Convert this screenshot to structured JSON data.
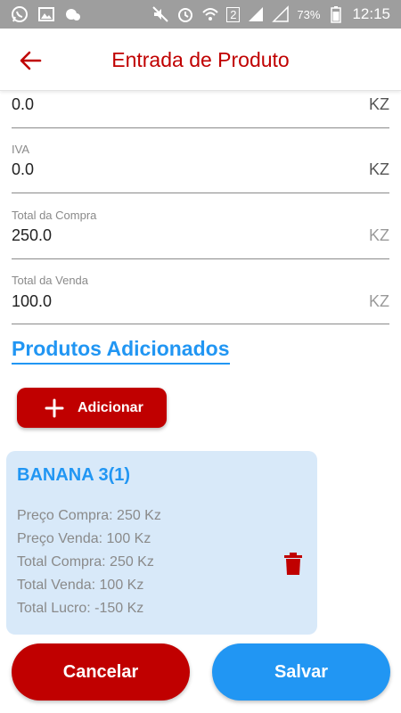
{
  "status_bar": {
    "battery": "73%",
    "time": "12:15",
    "sim_badge": "2"
  },
  "app_bar": {
    "title": "Entrada de Produto"
  },
  "fields": [
    {
      "label": "",
      "value": "0.0",
      "unit": "KZ"
    },
    {
      "label": "IVA",
      "value": "0.0",
      "unit": "KZ"
    },
    {
      "label": "Total da Compra",
      "value": "250.0",
      "unit": "KZ"
    },
    {
      "label": "Total da Venda",
      "value": "100.0",
      "unit": "KZ"
    }
  ],
  "section": {
    "title": "Produtos Adicionados"
  },
  "add_button": {
    "label": "Adicionar"
  },
  "product_card": {
    "title": "BANANA 3(1)",
    "lines": [
      "Preço Compra: 250 Kz",
      "Preço Venda: 100 Kz",
      "Total Compra: 250 Kz",
      "Total Venda: 100 Kz",
      "Total Lucro: -150 Kz"
    ]
  },
  "actions": {
    "cancel_label": "Cancelar",
    "save_label": "Salvar"
  },
  "colors": {
    "primary_red": "#c00000",
    "primary_blue": "#2196f3",
    "card_bg": "#d8e9f9"
  }
}
